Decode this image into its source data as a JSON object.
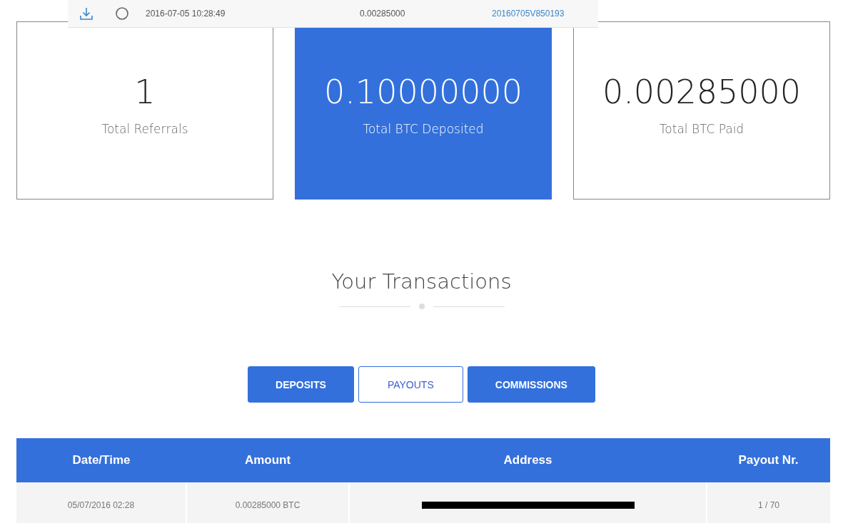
{
  "overlay_row": {
    "timestamp": "2016-07-05 10:28:49",
    "amount": "0.00285000",
    "reference": "20160705V850193"
  },
  "stats": [
    {
      "value": "1",
      "label": "Total Referrals",
      "highlighted": false
    },
    {
      "value": "0.10000000",
      "label": "Total BTC Deposited",
      "highlighted": true
    },
    {
      "value": "0.00285000",
      "label": "Total BTC Paid",
      "highlighted": false
    }
  ],
  "section_title": "Your Transactions",
  "tabs": [
    {
      "label": "DEPOSITS",
      "selected": false
    },
    {
      "label": "PAYOUTS",
      "selected": true
    },
    {
      "label": "COMMISSIONS",
      "selected": false
    }
  ],
  "table": {
    "columns": [
      "Date/Time",
      "Amount",
      "Address",
      "Payout Nr."
    ],
    "rows": [
      {
        "date_time": "05/07/2016 02:28",
        "amount": "0.00285000 BTC",
        "address_redacted": true,
        "payout_nr": "1 / 70"
      }
    ]
  }
}
